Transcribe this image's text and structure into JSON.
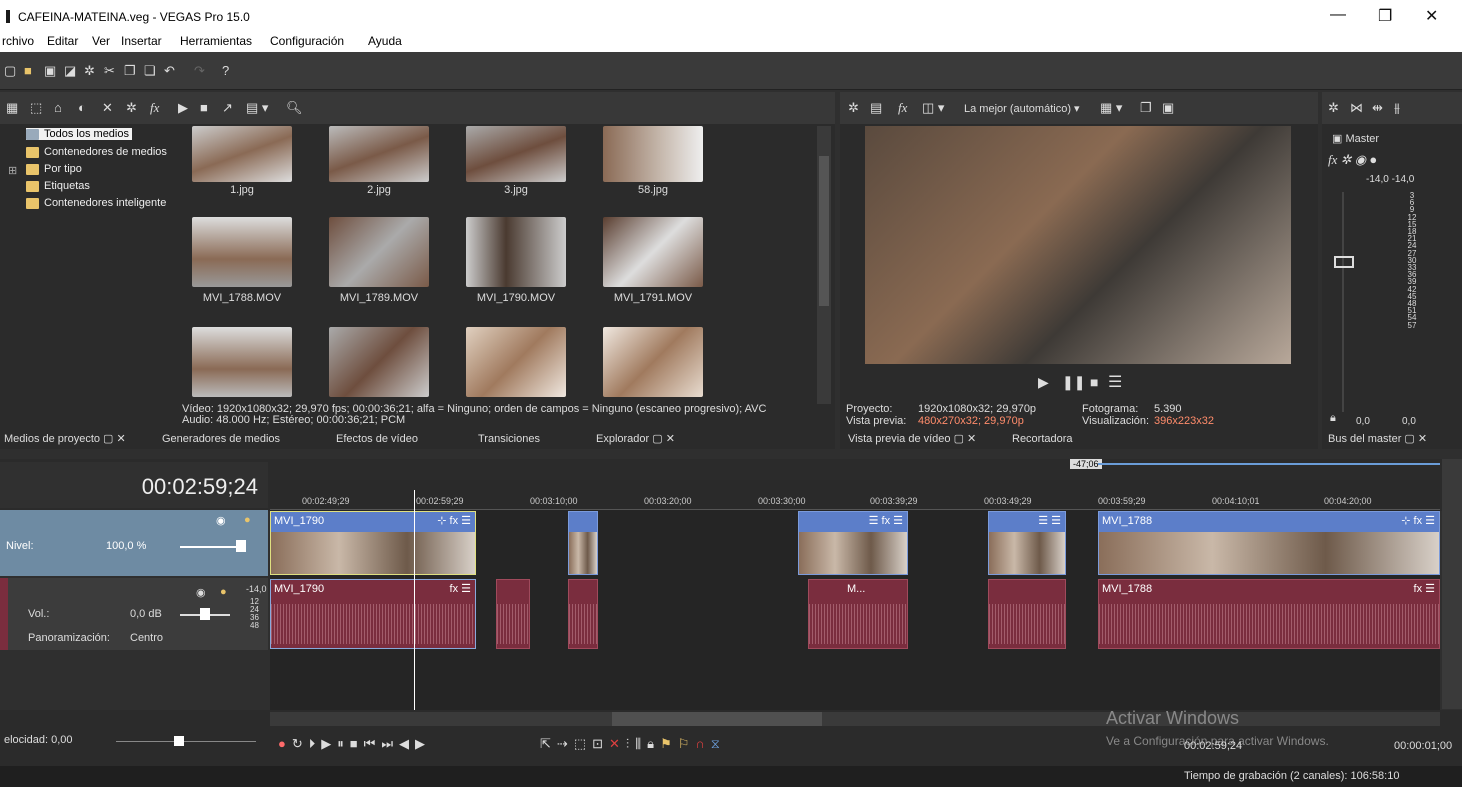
{
  "window": {
    "title": "CAFEINA-MATEINA.veg - VEGAS Pro 15.0",
    "minimize": "—",
    "maximize": "❐",
    "close": "✕"
  },
  "menu": [
    "rchivo",
    "Editar",
    "Ver",
    "Insertar",
    "Herramientas",
    "Configuración",
    "Ayuda"
  ],
  "media_tree": [
    "Todos los medios",
    "Contenedores de medios",
    "Por tipo",
    "Etiquetas",
    "Contenedores inteligente"
  ],
  "thumbs": [
    {
      "label": "1.jpg"
    },
    {
      "label": "2.jpg"
    },
    {
      "label": "3.jpg"
    },
    {
      "label": "58.jpg"
    },
    {
      "label": "MVI_1788.MOV"
    },
    {
      "label": "MVI_1789.MOV"
    },
    {
      "label": "MVI_1790.MOV"
    },
    {
      "label": "MVI_1791.MOV"
    }
  ],
  "media_info": {
    "line1": "Vídeo: 1920x1080x32; 29,970 fps; 00:00:36;21; alfa = Ninguno; orden de campos = Ninguno (escaneo progresivo); AVC",
    "line2": "Audio: 48.000 Hz; Estéreo; 00:00:36;21; PCM"
  },
  "tabs": {
    "medios": "Medios de proyecto",
    "generadores": "Generadores de medios",
    "efectos": "Efectos de vídeo",
    "transiciones": "Transiciones",
    "explorador": "Explorador",
    "vista_previa": "Vista previa de vídeo",
    "recortadora": "Recortadora",
    "bus": "Bus del master"
  },
  "preview": {
    "quality": "La mejor (automático)",
    "proyecto_label": "Proyecto:",
    "proyecto_value": "1920x1080x32; 29,970p",
    "vista_label": "Vista previa:",
    "vista_value": "480x270x32; 29,970p",
    "fotograma_label": "Fotograma:",
    "fotograma_value": "5.390",
    "visual_label": "Visualización:",
    "visual_value": "396x223x32"
  },
  "master": {
    "label": "Master",
    "levels": "-14,0  -14,0",
    "scale": [
      "3",
      "6",
      "9",
      "12",
      "15",
      "18",
      "21",
      "24",
      "27",
      "30",
      "33",
      "36",
      "39",
      "42",
      "45",
      "48",
      "51",
      "54",
      "57"
    ],
    "out_left": "0,0",
    "out_right": "0,0"
  },
  "timeline": {
    "timecode": "00:02:59;24",
    "marker": "-47;06",
    "ruler": [
      "00:02:49;29",
      "00:02:59;29",
      "00:03:10;00",
      "00:03:20;00",
      "00:03:30;00",
      "00:03:39;29",
      "00:03:49;29",
      "00:03:59;29",
      "00:04:10;01",
      "00:04:20;00"
    ]
  },
  "track1": {
    "nivel_label": "Nivel:",
    "nivel_value": "100,0 %"
  },
  "track2": {
    "vol_label": "Vol.:",
    "vol_value": "0,0 dB",
    "pan_label": "Panoramización:",
    "pan_value": "Centro",
    "db": "-14,0",
    "meter": [
      "12",
      "24",
      "36",
      "48"
    ]
  },
  "clips": {
    "video1": "MVI_1790",
    "video2": "MVI_1788",
    "audio1": "MVI_1790",
    "audio2": "M...",
    "audio3": "MVI_1788"
  },
  "transport": {
    "velocidad": "elocidad: 0,00",
    "time1": "00:02:59;24",
    "time2": "00:00:01;00"
  },
  "status": {
    "recording": "Tiempo de grabación (2 canales): 106:58:10"
  },
  "watermark": {
    "line1": "Activar Windows",
    "line2": "Ve a Configuración para activar Windows."
  }
}
